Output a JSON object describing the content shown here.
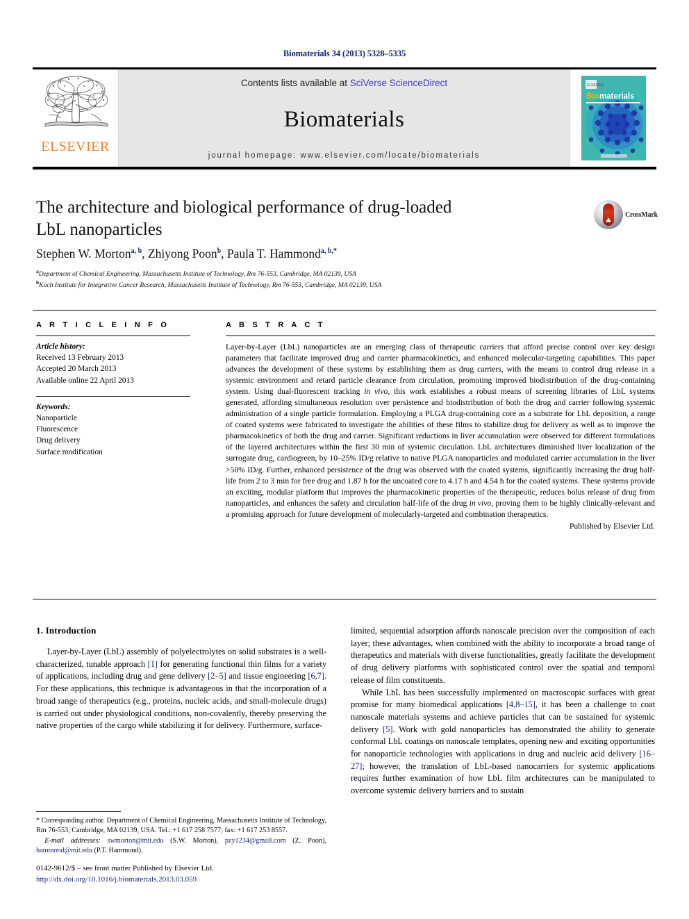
{
  "running_head": "Biomaterials 34 (2013) 5328–5335",
  "masthead": {
    "publisher_name": "ELSEVIER",
    "contents_prefix": "Contents lists available at ",
    "contents_link": "SciVerse ScienceDirect",
    "journal_name": "Biomaterials",
    "homepage": "journal homepage: www.elsevier.com/locate/biomaterials",
    "cover_title_bio": "Bio",
    "cover_title_materials": "materials",
    "link_color": "#3b3bb5",
    "brand_color": "#ef7d22",
    "band_color": "#e6e6e6"
  },
  "article": {
    "title": "The architecture and biological performance of drug-loaded LbL nanoparticles",
    "crossmark_label": "CrossMark",
    "authors": [
      {
        "name": "Stephen W. Morton",
        "sup": "a, b",
        "sep": ", "
      },
      {
        "name": "Zhiyong Poon",
        "sup": "b",
        "sep": ", "
      },
      {
        "name": "Paula T. Hammond",
        "sup": "a, b,",
        "sup_star": "*",
        "sep": ""
      }
    ],
    "affiliations": [
      {
        "mark": "a",
        "text": "Department of Chemical Engineering, Massachusetts Institute of Technology, Rm 76-553, Cambridge, MA 02139, USA"
      },
      {
        "mark": "b",
        "text": "Koch Institute for Integrative Cancer Research, Massachusetts Institute of Technology, Rm 76-553, Cambridge, MA 02139, USA"
      }
    ]
  },
  "article_info": {
    "heading": "A R T I C L E   I N F O",
    "history_label": "Article history:",
    "history": [
      "Received 13 February 2013",
      "Accepted 20 March 2013",
      "Available online 22 April 2013"
    ],
    "keywords_label": "Keywords:",
    "keywords": [
      "Nanoparticle",
      "Fluorescence",
      "Drug delivery",
      "Surface modification"
    ]
  },
  "abstract": {
    "heading": "A B S T R A C T",
    "paragraph_1": "Layer-by-Layer (LbL) nanoparticles are an emerging class of therapeutic carriers that afford precise control over key design parameters that facilitate improved drug and carrier pharmacokinetics, and enhanced molecular-targeting capabilities. This paper advances the development of these systems by establishing them as drug carriers, with the means to control drug release in a systemic environment and retard particle clearance from circulation, promoting improved biodistribution of the drug-containing system. Using dual-fluorescent tracking ",
    "italic_1": "in vivo",
    "paragraph_2": ", this work establishes a robust means of screening libraries of LbL systems generated, affording simultaneous resolution over persistence and biodistribution of both the drug and carrier following systemic administration of a single particle formulation. Employing a PLGA drug-containing core as a substrate for LbL deposition, a range of coated systems were fabricated to investigate the abilities of these films to stabilize drug for delivery as well as to improve the pharmacokinetics of both the drug and carrier. Significant reductions in liver accumulation were observed for different formulations of the layered architectures within the first 30 min of systemic circulation. LbL architectures diminished liver localization of the surrogate drug, cardiogreen, by 10–25% ID/g relative to native PLGA nanoparticles and modulated carrier accumulation in the liver >50% ID/g. Further, enhanced persistence of the drug was observed with the coated systems, significantly increasing the drug half-life from 2 to 3 min for free drug and 1.87 h for the uncoated core to 4.17 h and 4.54 h for the coated systems. These systems provide an exciting, modular platform that improves the pharmacokinetic properties of the therapeutic, reduces bolus release of drug from nanoparticles, and enhances the safety and circulation half-life of the drug ",
    "italic_2": "in vivo",
    "paragraph_3": ", proving them to be highly clinically-relevant and a promising approach for future development of molecularly-targeted and combination therapeutics.",
    "publisher_statement": "Published by Elsevier Ltd."
  },
  "body": {
    "section_heading": "1. Introduction",
    "left": {
      "p1_a": "Layer-by-Layer (LbL) assembly of polyelectrolytes on solid substrates is a well-characterized, tunable approach ",
      "p1_ref1": "[1]",
      "p1_b": " for generating functional thin films for a variety of applications, including drug and gene delivery ",
      "p1_ref2": "[2–5]",
      "p1_c": " and tissue engineering ",
      "p1_ref3": "[6,7]",
      "p1_d": ". For these applications, this technique is advantageous in that the incorporation of a broad range of therapeutics (e.g., proteins, nucleic acids, and small-molecule drugs) is carried out under physiological conditions, non-covalently, thereby preserving the native properties of the cargo while stabilizing it for delivery. Furthermore, surface-"
    },
    "right": {
      "p1": "limited, sequential adsorption affords nanoscale precision over the composition of each layer; these advantages, when combined with the ability to incorporate a broad range of therapeutics and materials with diverse functionalities, greatly facilitate the development of drug delivery platforms with sophisticated control over the spatial and temporal release of film constituents.",
      "p2_a": "While LbL has been successfully implemented on macroscopic surfaces with great promise for many biomedical applications ",
      "p2_ref1": "[4,8–15]",
      "p2_b": ", it has been a challenge to coat nanoscale materials systems and achieve particles that can be sustained for systemic delivery ",
      "p2_ref2": "[5]",
      "p2_c": ". Work with gold nanoparticles has demonstrated the ability to generate conformal LbL coatings on nanoscale templates, opening new and exciting opportunities for nanoparticle technologies with applications in drug and nucleic acid delivery ",
      "p2_ref3": "[16–27]",
      "p2_d": "; however, the translation of LbL-based nanocarriers for systemic applications requires further examination of how LbL film architectures can be manipulated to overcome systemic delivery barriers and to sustain"
    }
  },
  "footnote": {
    "corresponding": "* Corresponding author. Department of Chemical Engineering, Massachusetts Institute of Technology, Rm 76-553, Cambridge, MA 02139, USA. Tel.: +1 617 258 7577; fax: +1 617 253 8557.",
    "email_label": "E-mail addresses:",
    "emails": [
      {
        "address": "swmorton@mit.edu",
        "owner": " (S.W. Morton), "
      },
      {
        "address": "pzy1234@gmail.com",
        "owner": " (Z. Poon), "
      },
      {
        "address": "hammond@mit.edu",
        "owner": " (P.T. Hammond)."
      }
    ]
  },
  "imprint": {
    "line1": "0142-9612/$ – see front matter Published by Elsevier Ltd.",
    "doi": "http://dx.doi.org/10.1016/j.biomaterials.2013.03.059"
  }
}
